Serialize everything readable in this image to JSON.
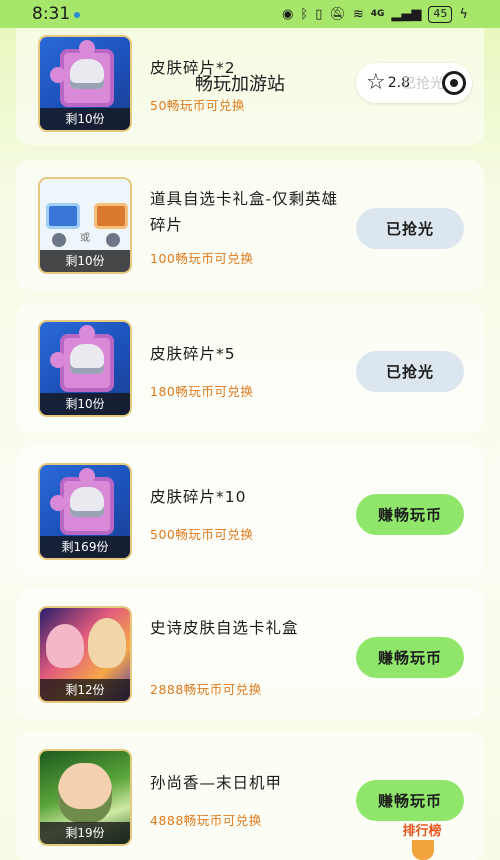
{
  "status_bar": {
    "time": "8:31",
    "network": "4G",
    "battery": "45"
  },
  "header": {
    "title": "畅玩加游站",
    "rating": "2.8",
    "ghost_text": "已抢光",
    "star_icon": "star-outline-icon",
    "target_icon": "target-icon"
  },
  "items": [
    {
      "title": "皮肤碎片*2",
      "price": "50畅玩币可兑换",
      "stock": "剩10份",
      "action": "已抢光",
      "action_type": "sold",
      "thumb": "skin"
    },
    {
      "title": "道具自选卡礼盒-仅剩英雄碎片",
      "price": "100畅玩币可兑换",
      "stock": "剩10份",
      "action": "已抢光",
      "action_type": "sold",
      "thumb": "props",
      "thumb_or": "或"
    },
    {
      "title": "皮肤碎片*5",
      "price": "180畅玩币可兑换",
      "stock": "剩10份",
      "action": "已抢光",
      "action_type": "sold",
      "thumb": "skin"
    },
    {
      "title": "皮肤碎片*10",
      "price": "500畅玩币可兑换",
      "stock": "剩169份",
      "action": "赚畅玩币",
      "action_type": "earn",
      "thumb": "skin"
    },
    {
      "title": "史诗皮肤自选卡礼盒",
      "price": "2888畅玩币可兑换",
      "stock": "剩12份",
      "action": "赚畅玩币",
      "action_type": "earn",
      "thumb": "epic"
    },
    {
      "title": "孙尚香—末日机甲",
      "price": "4888畅玩币可兑换",
      "stock": "剩19份",
      "action": "赚畅玩币",
      "action_type": "earn",
      "thumb": "sun"
    }
  ],
  "leaderboard": {
    "label": "排行榜"
  },
  "colors": {
    "accent_green": "#8fe66b",
    "price_orange": "#e07a1f",
    "sold_gray": "#dbe6ee"
  }
}
